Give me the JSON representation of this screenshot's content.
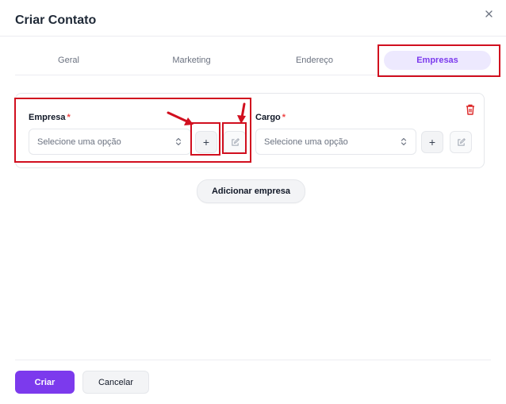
{
  "dialog": {
    "title": "Criar Contato"
  },
  "tabs": [
    {
      "label": "Geral",
      "active": false
    },
    {
      "label": "Marketing",
      "active": false
    },
    {
      "label": "Endereço",
      "active": false
    },
    {
      "label": "Empresas",
      "active": true
    }
  ],
  "company_card": {
    "empresa_label": "Empresa",
    "cargo_label": "Cargo",
    "required_mark": "*",
    "empresa_placeholder": "Selecione uma opção",
    "cargo_placeholder": "Selecione uma opção",
    "add_symbol": "+"
  },
  "add_company_button": "Adicionar empresa",
  "footer": {
    "primary_label": "Criar",
    "secondary_label": "Cancelar"
  },
  "colors": {
    "accent": "#7c3aed",
    "accent_light": "#ede9fe",
    "required": "#ef4444",
    "annotation": "#d10f1f",
    "delete": "#dc2626"
  },
  "icons": [
    "close-icon",
    "trash-icon",
    "chevron-updown-icon",
    "plus-icon",
    "edit-icon"
  ]
}
